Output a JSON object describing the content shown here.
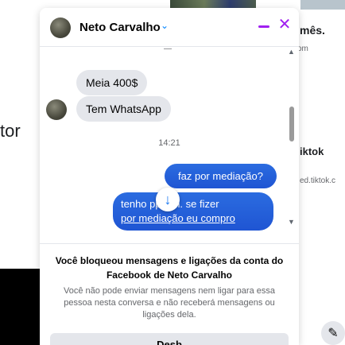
{
  "background": {
    "left_text": "tor",
    "right_heading": "mês.",
    "right_small": "om",
    "right_tiktok": "iktok",
    "right_url": "ed.tiktok.c"
  },
  "chat": {
    "contact_name": "Neto Carvalho",
    "header_dash": "—",
    "messages": [
      {
        "direction": "in",
        "text": "Meia 400$"
      },
      {
        "direction": "in",
        "text": "Tem WhatsApp"
      },
      {
        "direction": "out",
        "text": "faz por mediação?"
      },
      {
        "direction": "out",
        "line1": "tenho        pp sim. se fizer",
        "line2": "por mediação eu compro"
      }
    ],
    "timestamp": "14:21",
    "blocked": {
      "title": "Você bloqueou mensagens e ligações da conta do Facebook de Neto Carvalho",
      "description": "Você não pode enviar mensagens nem ligar para essa pessoa nesta conversa e não receberá mensagens ou ligações dela.",
      "button_label": "Desb"
    }
  },
  "colors": {
    "accent": "#a020f0",
    "outgoing_bubble": "#1f55d3",
    "incoming_bubble": "#e4e6eb"
  }
}
